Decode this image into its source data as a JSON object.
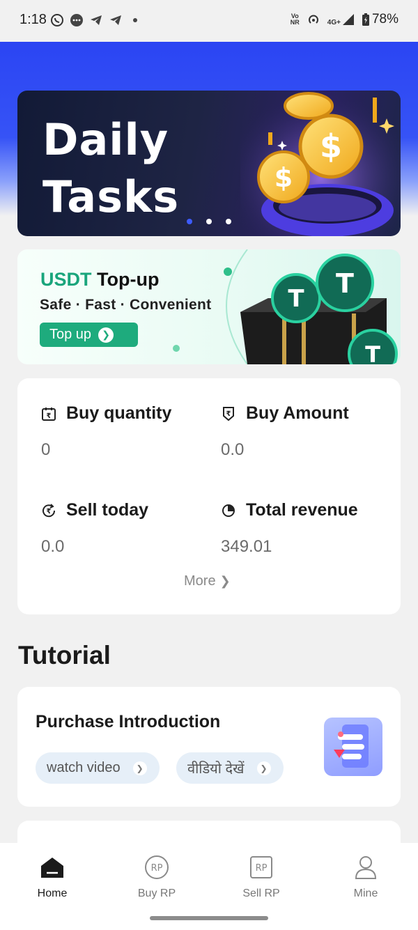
{
  "status_bar": {
    "time": "1:18",
    "left_icons": [
      "whatsapp-icon",
      "message-icon",
      "telegram-icon",
      "telegram-icon",
      "dot-icon"
    ],
    "volte": "Vo",
    "nr": "NR",
    "network": "4G+",
    "battery": "78%"
  },
  "banner": {
    "title": "Daily Tasks",
    "title_line1": "Daily",
    "title_line2": "Tasks",
    "carousel_pages": 3,
    "active_page": 1
  },
  "usdt_card": {
    "title_accent": "USDT",
    "title_rest": "Top-up",
    "subtitle": "Safe · Fast · Convenient",
    "button_label": "Top up"
  },
  "stats": {
    "items": [
      {
        "label": "Buy quantity",
        "value": "0",
        "icon": "calendar-rupee-icon"
      },
      {
        "label": "Buy Amount",
        "value": "0.0",
        "icon": "rupee-tag-icon"
      },
      {
        "label": "Sell today",
        "value": "0.0",
        "icon": "refresh-rupee-icon"
      },
      {
        "label": "Total revenue",
        "value": "349.01",
        "icon": "pie-chart-icon"
      }
    ],
    "more_label": "More"
  },
  "tutorial": {
    "section_title": "Tutorial",
    "card_title": "Purchase Introduction",
    "watch_label": "watch video",
    "watch_label_hi": "वीडियो देखें"
  },
  "bottom_nav": {
    "items": [
      {
        "label": "Home",
        "icon": "home-icon",
        "active": true
      },
      {
        "label": "Buy RP",
        "icon": "buy-rp-icon",
        "active": false
      },
      {
        "label": "Sell RP",
        "icon": "sell-rp-icon",
        "active": false
      },
      {
        "label": "Mine",
        "icon": "profile-icon",
        "active": false
      }
    ]
  },
  "colors": {
    "header_blue": "#2b45f3",
    "usdt_green": "#1aa57c",
    "carousel_active": "#3d5cff"
  }
}
